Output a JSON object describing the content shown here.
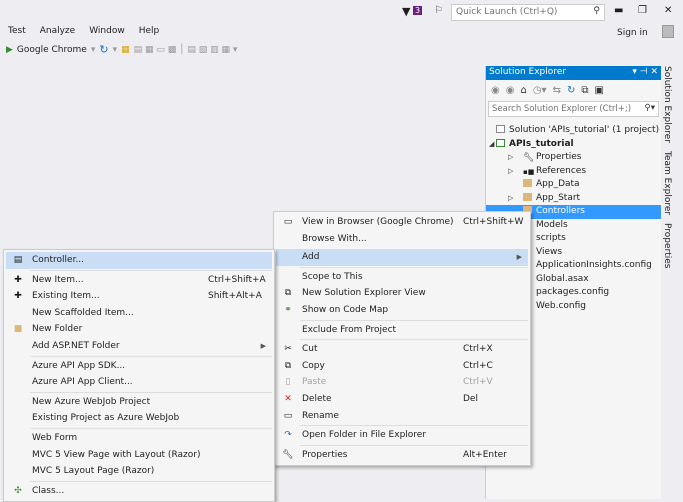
{
  "titlebar": {
    "notification_count": "3",
    "quick_launch_placeholder": "Quick Launch (Ctrl+Q)",
    "sign_in": "Sign in"
  },
  "menubar": [
    "Test",
    "Analyze",
    "Window",
    "Help"
  ],
  "toolbar": {
    "run_target": "Google Chrome"
  },
  "solution_explorer": {
    "title": "Solution Explorer",
    "search_placeholder": "Search Solution Explorer (Ctrl+;)",
    "tree": [
      {
        "label": "Solution 'APIs_tutorial' (1 project)"
      },
      {
        "label": "APIs_tutorial"
      },
      {
        "label": "Properties"
      },
      {
        "label": "References"
      },
      {
        "label": "App_Data"
      },
      {
        "label": "App_Start"
      },
      {
        "label": "Controllers"
      },
      {
        "label": "Models"
      },
      {
        "label": "scripts"
      },
      {
        "label": "Views"
      },
      {
        "label": "ApplicationInsights.config"
      },
      {
        "label": "Global.asax"
      },
      {
        "label": "packages.config"
      },
      {
        "label": "Web.config"
      }
    ]
  },
  "side_tabs": [
    "Solution Explorer",
    "Team Explorer",
    "Properties"
  ],
  "context_menu": [
    {
      "label": "View in Browser (Google Chrome)",
      "shortcut": "Ctrl+Shift+W"
    },
    {
      "label": "Browse With..."
    },
    {
      "label": "Add"
    },
    {
      "label": "Scope to This"
    },
    {
      "label": "New Solution Explorer View"
    },
    {
      "label": "Show on Code Map"
    },
    {
      "label": "Exclude From Project"
    },
    {
      "label": "Cut",
      "shortcut": "Ctrl+X"
    },
    {
      "label": "Copy",
      "shortcut": "Ctrl+C"
    },
    {
      "label": "Paste",
      "shortcut": "Ctrl+V"
    },
    {
      "label": "Delete",
      "shortcut": "Del"
    },
    {
      "label": "Rename"
    },
    {
      "label": "Open Folder in File Explorer"
    },
    {
      "label": "Properties",
      "shortcut": "Alt+Enter"
    }
  ],
  "add_submenu": [
    {
      "label": "Controller..."
    },
    {
      "label": "New Item...",
      "shortcut": "Ctrl+Shift+A"
    },
    {
      "label": "Existing Item...",
      "shortcut": "Shift+Alt+A"
    },
    {
      "label": "New Scaffolded Item..."
    },
    {
      "label": "New Folder"
    },
    {
      "label": "Add ASP.NET Folder"
    },
    {
      "label": "Azure API App SDK..."
    },
    {
      "label": "Azure API App Client..."
    },
    {
      "label": "New Azure WebJob Project"
    },
    {
      "label": "Existing Project as Azure WebJob"
    },
    {
      "label": "Web Form"
    },
    {
      "label": "MVC 5 View Page with Layout (Razor)"
    },
    {
      "label": "MVC 5 Layout Page (Razor)"
    },
    {
      "label": "Class..."
    }
  ]
}
